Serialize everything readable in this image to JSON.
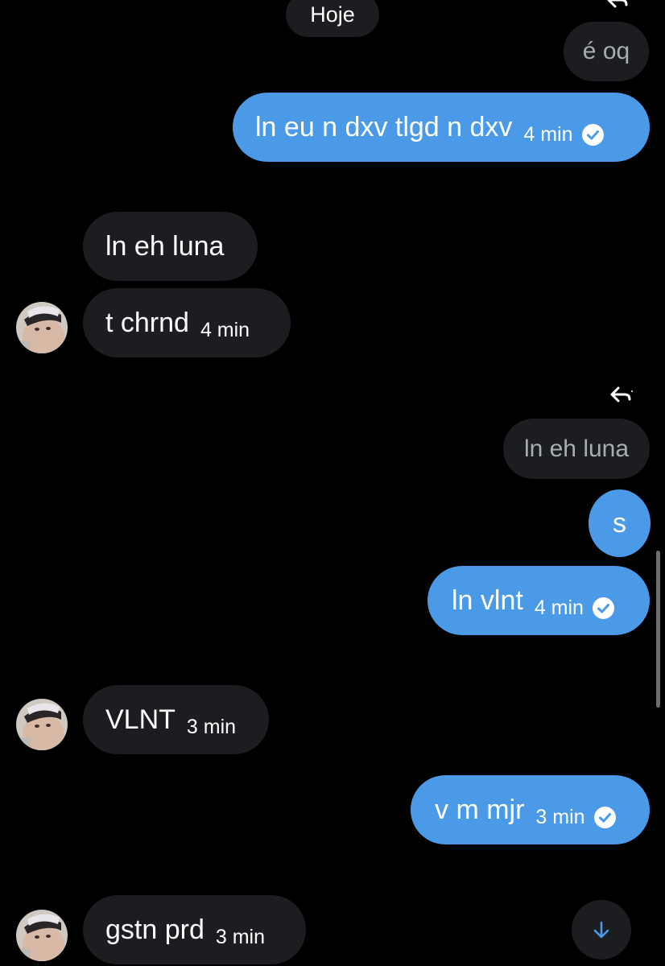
{
  "date_separator": "Hoje",
  "colors": {
    "sent_bubble": "#4a9ae8",
    "received_bubble": "#1c1d20",
    "background": "#000000",
    "quoted_text": "#a9acb1"
  },
  "icons": {
    "read_receipt": "check-circle-icon",
    "reply": "reply-arrow-icon",
    "scroll_down": "arrow-down-icon"
  },
  "messages": [
    {
      "type": "quoted",
      "text": "é oq"
    },
    {
      "type": "sent",
      "text": "ln eu n dxv tlgd n dxv",
      "time": "4 min"
    },
    {
      "type": "received",
      "text": "ln eh luna"
    },
    {
      "type": "received",
      "text": "t chrnd",
      "time": "4 min"
    },
    {
      "type": "quoted",
      "text": "ln eh luna"
    },
    {
      "type": "sent",
      "text": "s"
    },
    {
      "type": "sent",
      "text": "ln vlnt",
      "time": "4 min"
    },
    {
      "type": "received",
      "text": "VLNT",
      "time": "3 min"
    },
    {
      "type": "sent",
      "text": "v m mjr",
      "time": "3 min"
    },
    {
      "type": "received",
      "text": "gstn prd",
      "time": "3 min"
    }
  ]
}
